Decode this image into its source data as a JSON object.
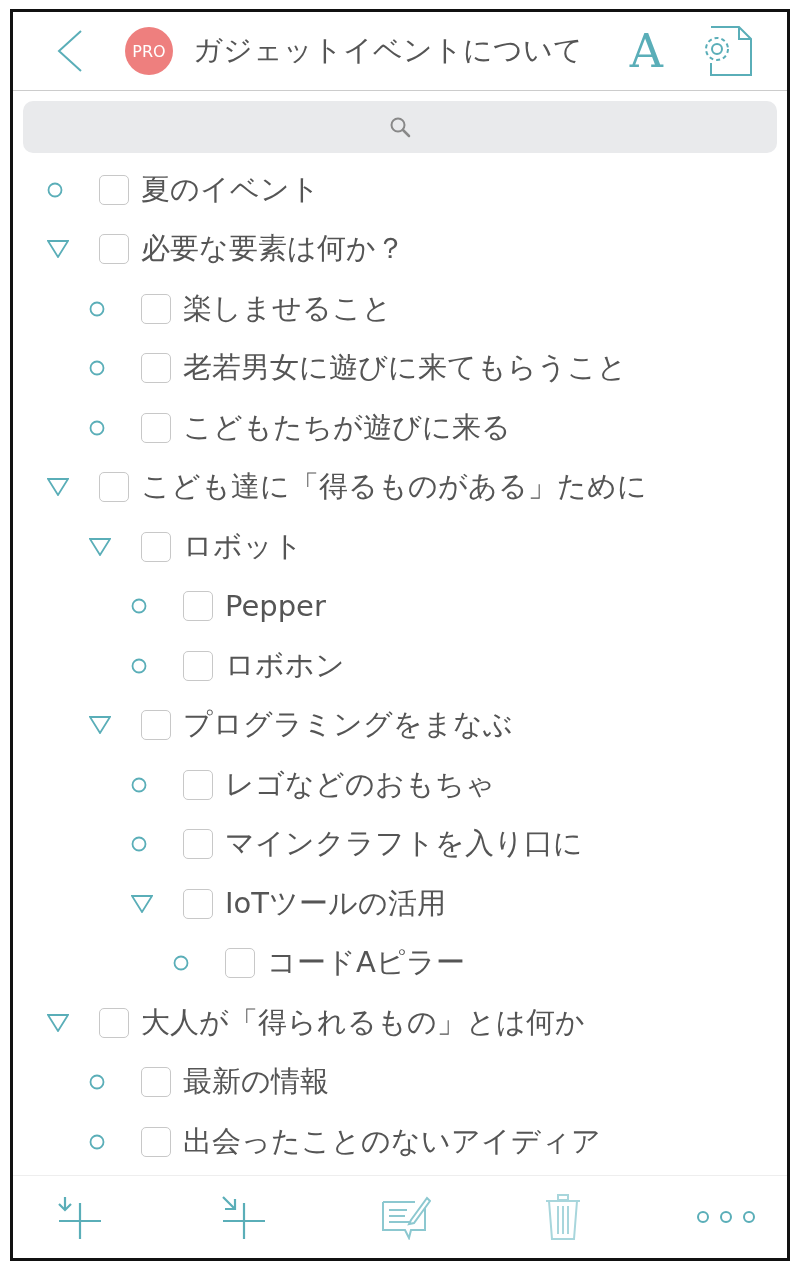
{
  "header": {
    "badge": "PRO",
    "title": "ガジェットイベントについて",
    "font_button": "A"
  },
  "outline": [
    {
      "kind": "bullet",
      "checked": false,
      "text": "夏のイベント"
    },
    {
      "kind": "branch",
      "checked": false,
      "text": "必要な要素は何か？",
      "children": [
        {
          "kind": "bullet",
          "checked": false,
          "text": "楽しませること"
        },
        {
          "kind": "bullet",
          "checked": false,
          "text": "老若男女に遊びに来てもらうこと"
        },
        {
          "kind": "bullet",
          "checked": false,
          "text": "こどもたちが遊びに来る"
        }
      ]
    },
    {
      "kind": "branch",
      "checked": false,
      "text": "こども達に「得るものがある」ために",
      "children": [
        {
          "kind": "branch",
          "checked": false,
          "text": "ロボット",
          "children": [
            {
              "kind": "bullet",
              "checked": false,
              "text": "Pepper"
            },
            {
              "kind": "bullet",
              "checked": false,
              "text": "ロボホン"
            }
          ]
        },
        {
          "kind": "branch",
          "checked": false,
          "text": "プログラミングをまなぶ",
          "children": [
            {
              "kind": "bullet",
              "checked": false,
              "text": "レゴなどのおもちゃ"
            },
            {
              "kind": "bullet",
              "checked": false,
              "text": "マインクラフトを入り口に"
            },
            {
              "kind": "branch",
              "checked": false,
              "text": "IoTツールの活用",
              "children": [
                {
                  "kind": "bullet",
                  "checked": false,
                  "text": "コードAピラー"
                }
              ]
            }
          ]
        }
      ]
    },
    {
      "kind": "branch",
      "checked": false,
      "text": "大人が「得られるもの」とは何か",
      "children": [
        {
          "kind": "bullet",
          "checked": false,
          "text": "最新の情報"
        },
        {
          "kind": "bullet",
          "checked": false,
          "text": "出会ったことのないアイディア"
        }
      ]
    }
  ]
}
